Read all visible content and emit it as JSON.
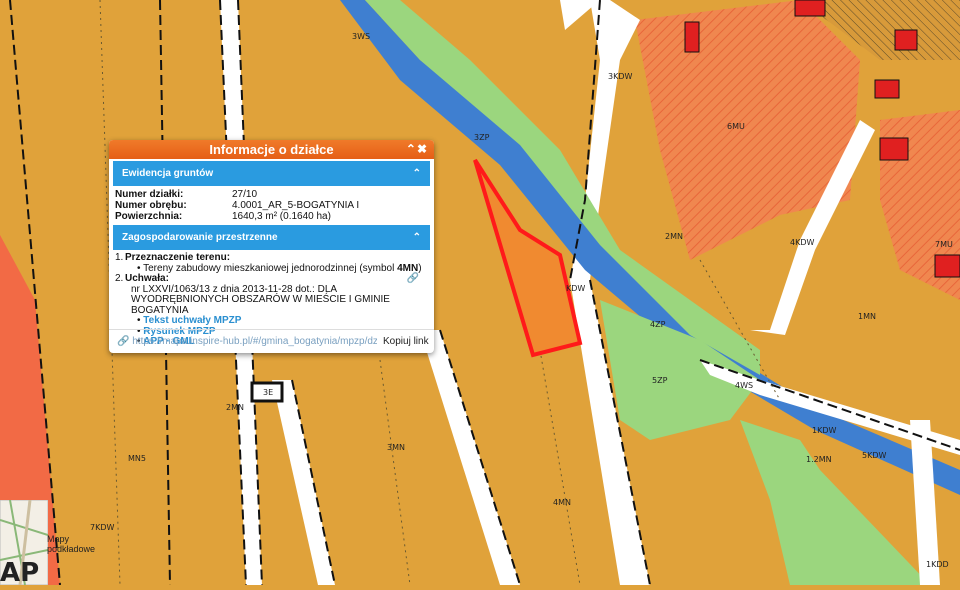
{
  "popup": {
    "title": "Informacje o działce",
    "controls": "⌃✖",
    "section_land": "Ewidencja gruntów",
    "rows": [
      {
        "label": "Numer działki:",
        "value": "27/10"
      },
      {
        "label": "Numer obrębu:",
        "value": "4.0001_AR_5-BOGATYNIA I"
      },
      {
        "label": "Powierzchnia:",
        "value": "1640,3 m² (0.1640 ha)"
      }
    ],
    "section_plan": "Zagospodarowanie przestrzenne",
    "plan": {
      "item1_num": "1.",
      "item1_title": "Przeznaczenie terenu:",
      "item1_desc": "Tereny zabudowy mieszkaniowej jednorodzinnej (symbol ",
      "item1_symbol": "4MN",
      "item1_close": ")",
      "item2_num": "2.",
      "item2_title": "Uchwała:",
      "item2_text1": "nr LXXVI/1063/13 z dnia 2013-11-28 dot.: DLA",
      "item2_text2": "WYODRĘBNIONYCH OBSZARÓW W MIEŚCIE I GMINIE BOGATYNIA",
      "links": [
        "Tekst uchwały MPZP",
        "Rysunek MPZP",
        "APP · GML"
      ]
    },
    "url": "https://mapa.inspire-hub.pl/#/gmina_bogatynia/mpzp/dzi...",
    "copy_label": "Kopiuj link"
  },
  "basemap": {
    "label1": "Mapy",
    "label2": "podkładowe"
  },
  "zone_labels": [
    {
      "text": "3WS"
    },
    {
      "text": "3KDW"
    },
    {
      "text": "3ZP"
    },
    {
      "text": "6MU"
    },
    {
      "text": "2MN"
    },
    {
      "text": "4KDW"
    },
    {
      "text": "7MU"
    },
    {
      "text": "KDW"
    },
    {
      "text": "4ZP"
    },
    {
      "text": "1MN"
    },
    {
      "text": "5ZP"
    },
    {
      "text": "4WS"
    },
    {
      "text": "3E"
    },
    {
      "text": "2MN"
    },
    {
      "text": "3MN"
    },
    {
      "text": "MN5"
    },
    {
      "text": "1KDW"
    },
    {
      "text": "1.2MN"
    },
    {
      "text": "5KDW"
    },
    {
      "text": "4MN"
    },
    {
      "text": "7KDW"
    },
    {
      "text": "1KDD"
    }
  ],
  "colors": {
    "residential": "#e0a23a",
    "mixed": "#f08a55",
    "water": "#3f7fd0",
    "green": "#9bd67e",
    "selected": "#ff1a1a",
    "popup_header": "#e8641b",
    "section": "#2a9be0"
  }
}
